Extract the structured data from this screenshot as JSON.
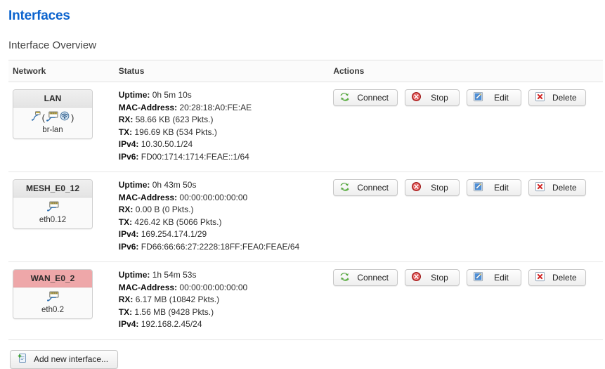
{
  "page": {
    "title": "Interfaces",
    "section_title": "Interface Overview"
  },
  "table": {
    "headers": {
      "network": "Network",
      "status": "Status",
      "actions": "Actions"
    }
  },
  "labels": {
    "uptime": "Uptime:",
    "mac": "MAC-Address:",
    "rx": "RX",
    "tx": "TX",
    "ipv4": "IPv4:",
    "ipv6": "IPv6:",
    "rx_sep": ":",
    "tx_sep": ":"
  },
  "buttons": {
    "connect": "Connect",
    "stop": "Stop",
    "edit": "Edit",
    "delete": "Delete",
    "add_new_interface": "Add new interface..."
  },
  "icons": {
    "connect": "refresh-green-icon",
    "stop": "stop-red-icon",
    "edit": "edit-pencil-icon",
    "delete": "delete-x-icon",
    "add": "add-page-icon",
    "bridge": "bridge-icon",
    "ethernet": "ethernet-icon",
    "wifi": "wifi-icon"
  },
  "colors": {
    "title": "#0b63ce",
    "wan_badge": "#eea7a9",
    "connect_icon": "#4fae3e",
    "stop_icon": "#cc2222",
    "edit_icon": "#3a78c8",
    "delete_icon": "#cc2222"
  },
  "interfaces": [
    {
      "name": "LAN",
      "device": "br-lan",
      "is_wan": false,
      "icons": [
        "bridge-icon",
        "ethernet-icon",
        "wifi-icon"
      ],
      "bridge": true,
      "uptime": "0h 5m 10s",
      "mac": "20:28:18:A0:FE:AE",
      "rx": "58.66 KB (623 Pkts.)",
      "tx": "196.69 KB (534 Pkts.)",
      "ipv4": "10.30.50.1/24",
      "ipv6": "FD00:1714:1714:FEAE::1/64"
    },
    {
      "name": "MESH_E0_12",
      "device": "eth0.12",
      "is_wan": false,
      "icons": [
        "ethernet-icon"
      ],
      "bridge": false,
      "uptime": "0h 43m 50s",
      "mac": "00:00:00:00:00:00",
      "rx": "0.00 B (0 Pkts.)",
      "tx": "426.42 KB (5066 Pkts.)",
      "ipv4": "169.254.174.1/29",
      "ipv6": "FD66:66:66:27:2228:18FF:FEA0:FEAE/64"
    },
    {
      "name": "WAN_E0_2",
      "device": "eth0.2",
      "is_wan": true,
      "icons": [
        "ethernet-icon"
      ],
      "bridge": false,
      "uptime": "1h 54m 53s",
      "mac": "00:00:00:00:00:00",
      "rx": "6.17 MB (10842 Pkts.)",
      "tx": "1.56 MB (9428 Pkts.)",
      "ipv4": "192.168.2.45/24",
      "ipv6": null
    }
  ]
}
